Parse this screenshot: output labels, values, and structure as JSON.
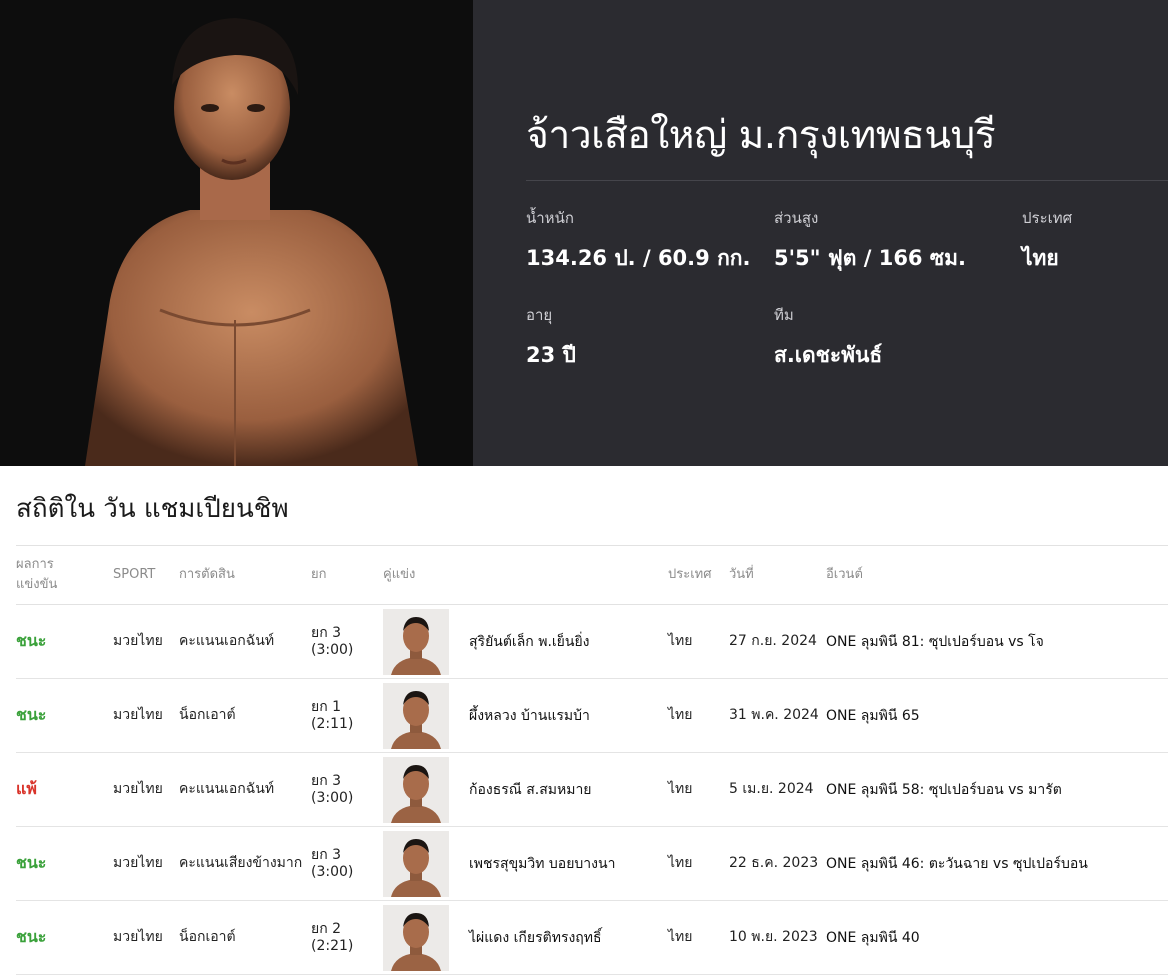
{
  "fighter": {
    "name": "จ้าวเสือใหญ่ ม.กรุงเทพธนบุรี",
    "stats": [
      {
        "label": "น้ำหนัก",
        "value": "134.26 ป. / 60.9 กก."
      },
      {
        "label": "ส่วนสูง",
        "value": "5'5\" ฟุต / 166 ซม."
      },
      {
        "label": "ประเทศ",
        "value": "ไทย"
      },
      {
        "label": "อายุ",
        "value": "23 ปี"
      },
      {
        "label": "ทีม",
        "value": "ส.เดชะพันธ์"
      }
    ]
  },
  "record": {
    "title": "สถิติใน วัน แชมเปียนชิพ",
    "headers": {
      "result": "ผลการแข่งขัน",
      "sport": "SPORT",
      "method": "การตัดสิน",
      "round": "ยก",
      "opponent": "คู่แข่ง",
      "country": "ประเทศ",
      "date": "วันที่",
      "event": "อีเวนต์"
    },
    "rows": [
      {
        "result": "ชนะ",
        "outcome": "win",
        "sport": "มวยไทย",
        "method": "คะแนนเอกฉันท์",
        "round": "ยก 3",
        "time": "(3:00)",
        "opponent": "สุริยันต์เล็ก พ.เย็นยิ่ง",
        "country": "ไทย",
        "date": "27 ก.ย. 2024",
        "event": "ONE ลุมพินี 81: ซุปเปอร์บอน vs โจ"
      },
      {
        "result": "ชนะ",
        "outcome": "win",
        "sport": "มวยไทย",
        "method": "น็อกเอาต์",
        "round": "ยก 1",
        "time": "(2:11)",
        "opponent": "ผึ้งหลวง บ้านแรมบ้า",
        "country": "ไทย",
        "date": "31 พ.ค. 2024",
        "event": "ONE ลุมพินี 65"
      },
      {
        "result": "แพ้",
        "outcome": "loss",
        "sport": "มวยไทย",
        "method": "คะแนนเอกฉันท์",
        "round": "ยก 3",
        "time": "(3:00)",
        "opponent": "ก้องธรณี ส.สมหมาย",
        "country": "ไทย",
        "date": "5 เม.ย. 2024",
        "event": "ONE ลุมพินี 58: ซุปเปอร์บอน vs มารัต"
      },
      {
        "result": "ชนะ",
        "outcome": "win",
        "sport": "มวยไทย",
        "method": "คะแนนเสียงข้างมาก",
        "round": "ยก 3",
        "time": "(3:00)",
        "opponent": "เพชรสุขุมวิท บอยบางนา",
        "country": "ไทย",
        "date": "22 ธ.ค. 2023",
        "event": "ONE ลุมพินี 46: ตะวันฉาย vs ซุปเปอร์บอน"
      },
      {
        "result": "ชนะ",
        "outcome": "win",
        "sport": "มวยไทย",
        "method": "น็อกเอาต์",
        "round": "ยก 2",
        "time": "(2:21)",
        "opponent": "ไผ่แดง เกียรติทรงฤทธิ์",
        "country": "ไทย",
        "date": "10 พ.ย. 2023",
        "event": "ONE ลุมพินี 40"
      }
    ]
  }
}
